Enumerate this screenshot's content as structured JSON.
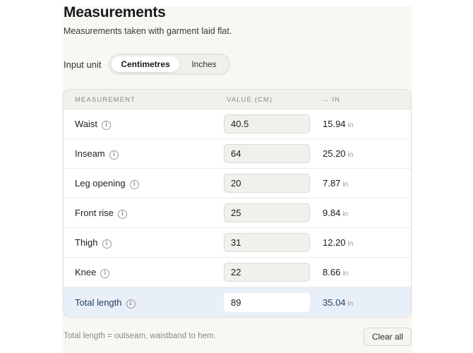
{
  "header": {
    "title": "Measurements",
    "subtitle": "Measurements taken with garment laid flat."
  },
  "unit_toggle": {
    "label": "Input unit",
    "options": [
      "Centimetres",
      "Inches"
    ],
    "selected": "Centimetres"
  },
  "table": {
    "headers": {
      "measurement": "MEASUREMENT",
      "value": "VALUE (CM)",
      "converted": "→ IN"
    },
    "unit_suffix": "in",
    "rows": [
      {
        "name": "Waist",
        "value": "40.5",
        "inches": "15.94"
      },
      {
        "name": "Inseam",
        "value": "64",
        "inches": "25.20"
      },
      {
        "name": "Leg opening",
        "value": "20",
        "inches": "7.87"
      },
      {
        "name": "Front rise",
        "value": "25",
        "inches": "9.84"
      },
      {
        "name": "Thigh",
        "value": "31",
        "inches": "12.20"
      },
      {
        "name": "Knee",
        "value": "22",
        "inches": "8.66"
      },
      {
        "name": "Total length",
        "value": "89",
        "inches": "35.04"
      }
    ]
  },
  "footer": {
    "note": "Total length = outseam, waistband to hem.",
    "clear_label": "Clear all"
  },
  "icons": {
    "info": "info-icon"
  },
  "colors": {
    "highlight_row": "#e9eff8",
    "highlight_text": "#1f3d5c"
  }
}
